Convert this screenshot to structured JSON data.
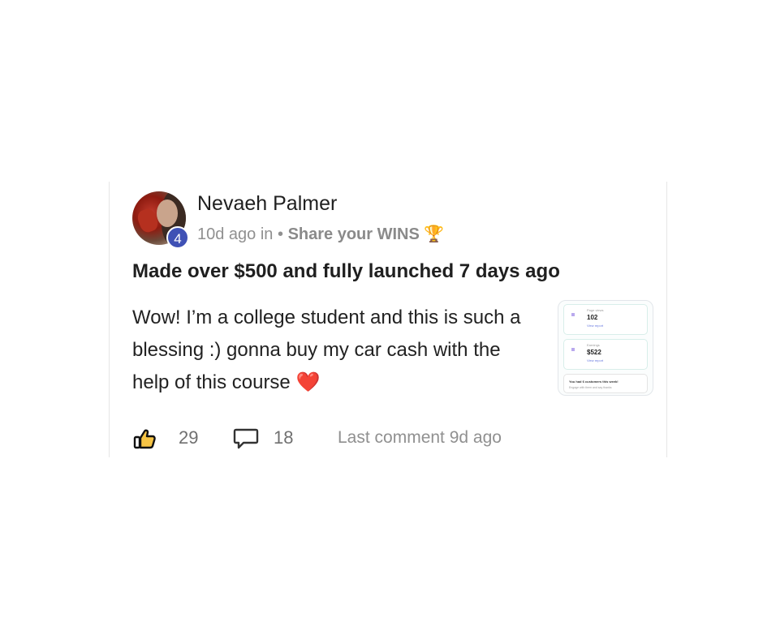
{
  "post": {
    "author": "Nevaeh Palmer",
    "level": "4",
    "time_ago": "10d ago in",
    "separator": "•",
    "category": "Share your WINS",
    "category_emoji": "🏆",
    "title": "Made over $500 and fully launched 7 days ago",
    "body": "Wow! I’m a college student and this is such a blessing :) gonna buy my car cash with the help of this course",
    "body_emoji": "❤️",
    "attachment": {
      "card1_label": "Page views",
      "card1_value": "102",
      "card1_link": "View report",
      "card2_label": "Earnings",
      "card2_value": "$522",
      "card2_link": "View report",
      "message_title": "You had 6 customers this week!",
      "message_sub": "Engage with them and say thanks"
    }
  },
  "footer": {
    "likes": "29",
    "comments": "18",
    "last_comment": "Last comment 9d ago"
  },
  "icons": {
    "like": "thumbs-up-icon",
    "comment": "comment-icon"
  },
  "colors": {
    "level_badge": "#3f51b5",
    "muted_text": "#909090"
  }
}
